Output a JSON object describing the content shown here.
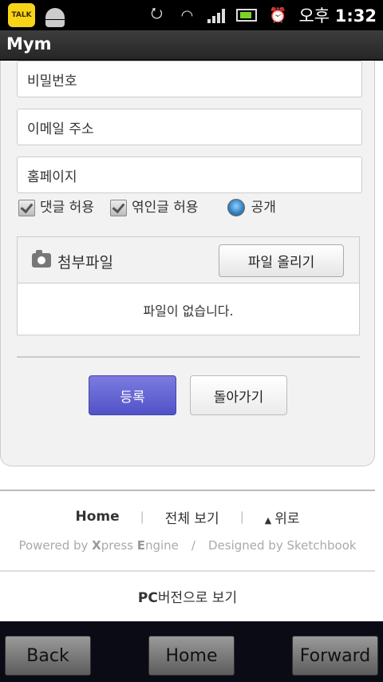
{
  "status_bar": {
    "talk_label": "TALK",
    "time_prefix": "오후",
    "time": "1:32",
    "icons": [
      "kakaotalk-icon",
      "android-icon",
      "rotate-icon",
      "wifi-icon",
      "signal-icon",
      "battery-icon",
      "alarm-icon"
    ]
  },
  "app": {
    "title": "Mym"
  },
  "form": {
    "password_field": "비밀번호",
    "email_field": "이메일 주소",
    "homepage_field": "홈페이지",
    "allow_comments": "댓글 허용",
    "allow_trackbacks": "엮인글 허용",
    "public_option": "공개",
    "attachment_label": "첨부파일",
    "upload_button": "파일 올리기",
    "no_files_text": "파일이 없습니다.",
    "submit_button": "등록",
    "back_button": "돌아가기"
  },
  "footer": {
    "home": "Home",
    "view_all": "전체 보기",
    "top": "위로",
    "powered_prefix": "Powered by ",
    "xe_x": "X",
    "xe_press": "press ",
    "xe_e": "E",
    "xe_ngine": "ngine",
    "slash": "/",
    "designed_by": "Designed by Sketchbook",
    "pc_bold": "PC",
    "pc_rest": "버전으로 보기"
  },
  "browser_nav": {
    "back": "Back",
    "home": "Home",
    "forward": "Forward"
  }
}
